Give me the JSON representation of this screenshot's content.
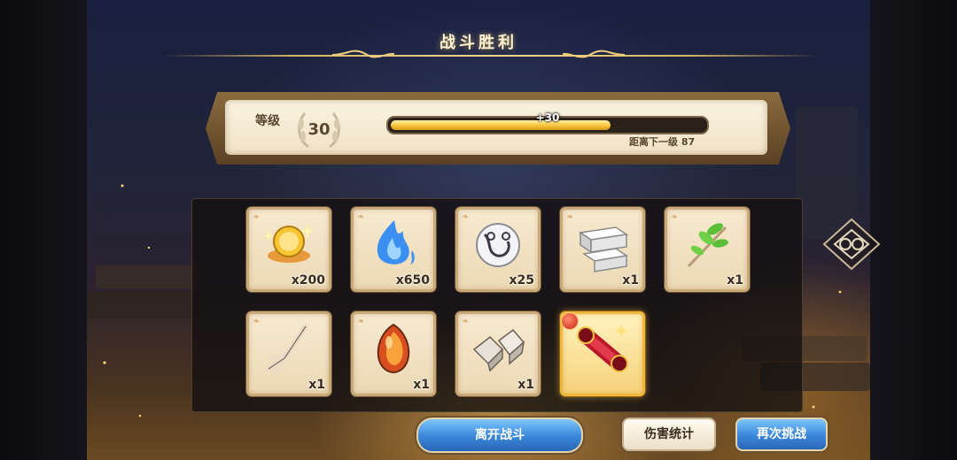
{
  "header": {
    "title": "战斗胜利"
  },
  "level": {
    "label": "等级",
    "value": "30",
    "xp_gain": "+30",
    "xp_progress": 0.7,
    "next_level_text": "距离下一级 87"
  },
  "rewards": [
    {
      "name": "gold-coin-pile",
      "quantity": "x200",
      "rare": false
    },
    {
      "name": "blue-spirit-flame",
      "quantity": "x650",
      "rare": false
    },
    {
      "name": "crystal-orb",
      "quantity": "x25",
      "rare": false
    },
    {
      "name": "stone-bricks",
      "quantity": "x1",
      "rare": false
    },
    {
      "name": "green-herb-sprig",
      "quantity": "x1",
      "rare": false
    },
    {
      "name": "root-branch",
      "quantity": "x1",
      "rare": false
    },
    {
      "name": "amber-seed",
      "quantity": "x1",
      "rare": false
    },
    {
      "name": "stone-shards",
      "quantity": "x1",
      "rare": false
    },
    {
      "name": "red-scroll",
      "quantity": "",
      "rare": true
    }
  ],
  "buttons": {
    "leave": "离开战斗",
    "stats": "伤害统计",
    "retry": "再次挑战"
  },
  "colors": {
    "xp_fill": "#f7c43a",
    "button_blue": "#3a86d8",
    "panel_cream": "#fbf3e1",
    "gold_trim": "#d7b464"
  }
}
